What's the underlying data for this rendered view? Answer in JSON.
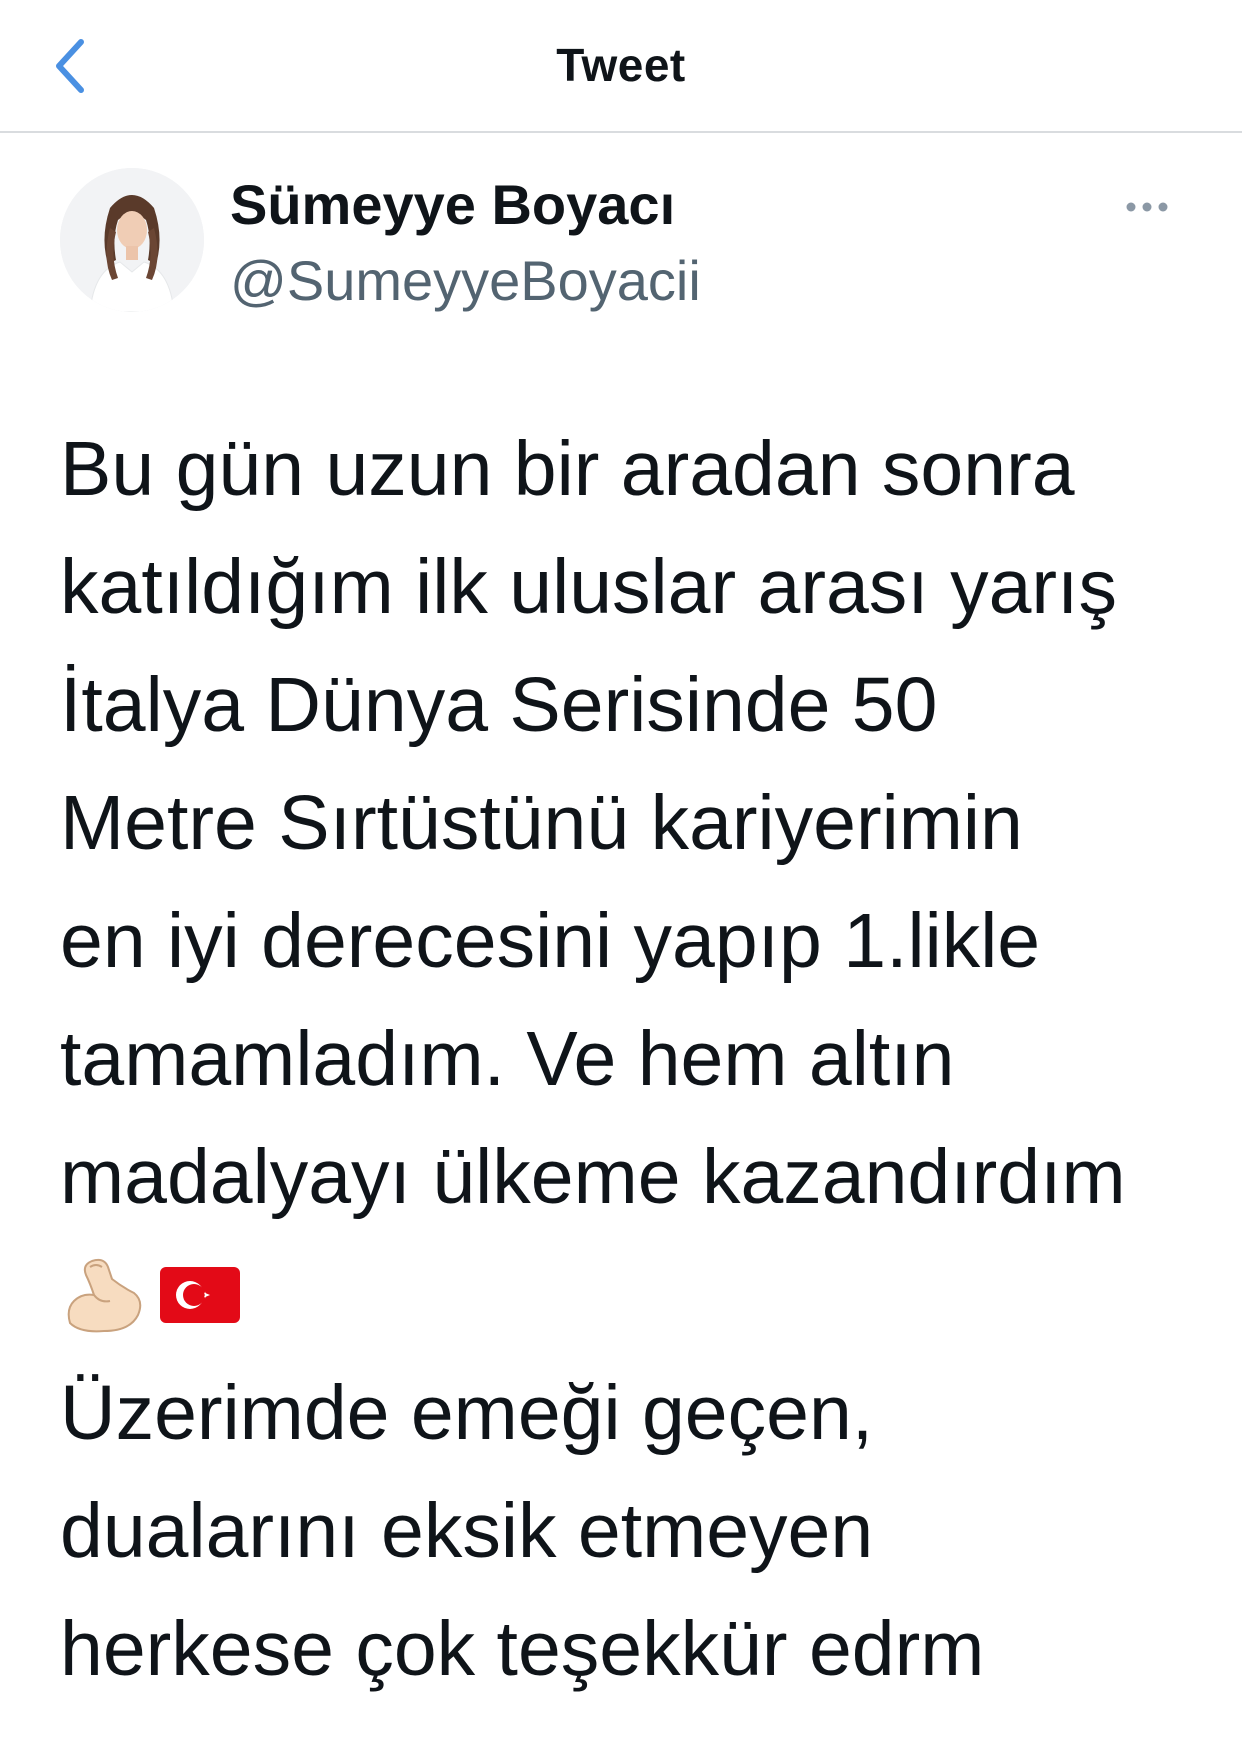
{
  "header": {
    "title": "Tweet",
    "back_icon": "chevron-left-icon",
    "accent_color": "#4a90e2"
  },
  "author": {
    "display_name": "Sümeyye Boyacı",
    "handle": "@SumeyyeBoyacii",
    "more_icon": "more-horizontal-icon"
  },
  "tweet": {
    "lines": [
      "Bu gün uzun bir aradan sonra",
      "katıldığım ilk uluslar arası yarış",
      "İtalya Dünya Serisinde 50",
      "Metre Sırtüstünü kariyerimin",
      "en iyi derecesini yapıp 1.likle",
      "tamamladım. Ve hem altın",
      "madalyayı ülkeme kazandırdım"
    ],
    "emojis": [
      "flexed-biceps-emoji",
      "turkey-flag-emoji"
    ],
    "lines_after": [
      "Üzerimde emeği geçen,",
      "dualarını eksik etmeyen",
      "herkese çok teşekkür edrm"
    ]
  },
  "colors": {
    "text": "#0f1419",
    "secondary_text": "#536471",
    "divider": "#d9dcdf",
    "flag_red": "#e30a17"
  }
}
